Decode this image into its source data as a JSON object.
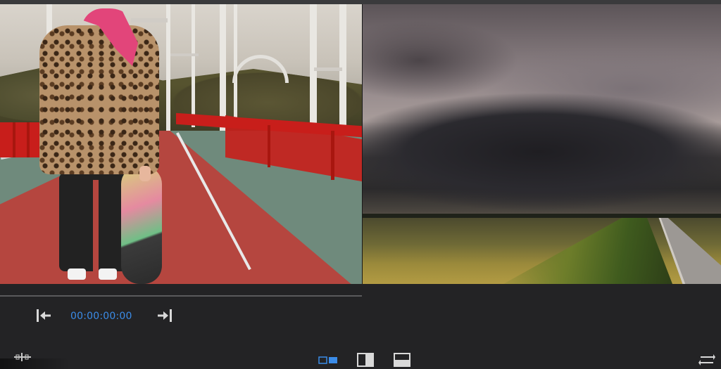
{
  "player": {
    "timecode": "00:00:00:00"
  },
  "controls": {
    "go_to_start_icon": "go-to-start-icon",
    "go_to_end_icon": "go-to-end-icon",
    "bottom_left_icon": "trim-marker-icon",
    "swap_icon": "swap-icon"
  },
  "view_modes": [
    {
      "icon": "side-by-side-view-icon",
      "active": true
    },
    {
      "icon": "split-view-icon",
      "active": false
    },
    {
      "icon": "over-under-view-icon",
      "active": false
    }
  ],
  "colors": {
    "background": "#232325",
    "accent": "#3b8ce8",
    "icon": "#d9d9d9"
  }
}
